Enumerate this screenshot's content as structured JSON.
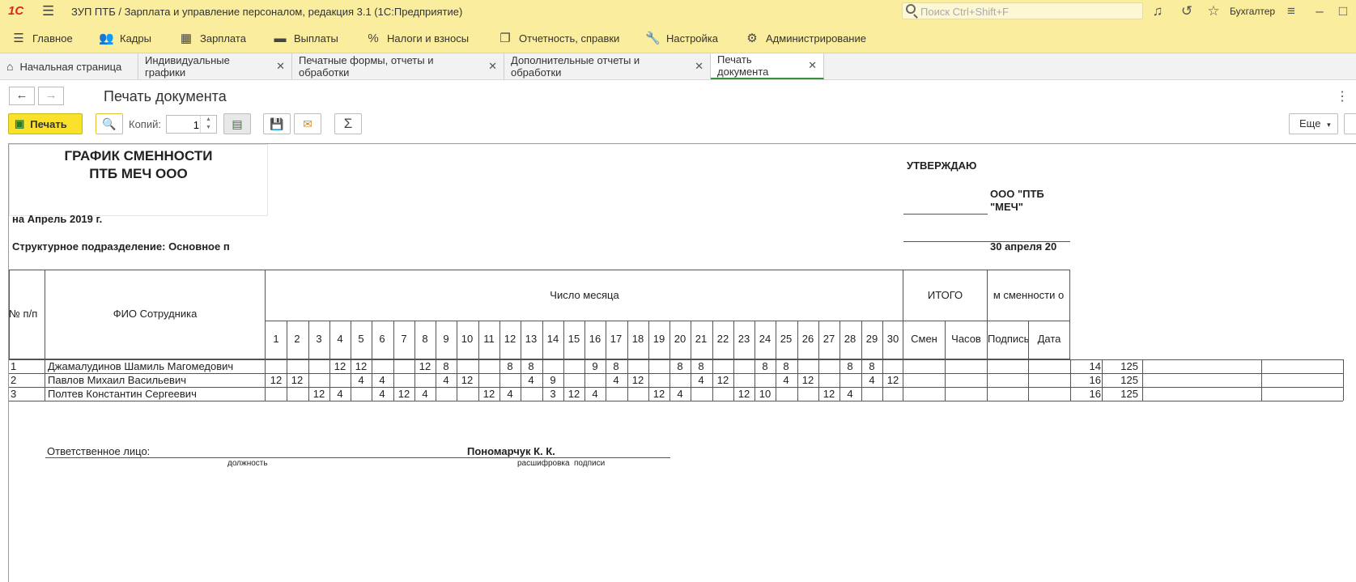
{
  "window": {
    "logo": "1С",
    "title": "ЗУП ПТБ / Зарплата и управление персоналом, редакция 3.1  (1С:Предприятие)",
    "search_placeholder": "Поиск Ctrl+Shift+F",
    "user": "Бухгалтер"
  },
  "sections": [
    {
      "label": "Главное",
      "icon": "menu-lines-icon"
    },
    {
      "label": "Кадры",
      "icon": "people-icon"
    },
    {
      "label": "Зарплата",
      "icon": "calculator-icon"
    },
    {
      "label": "Выплаты",
      "icon": "wallet-icon"
    },
    {
      "label": "Налоги и взносы",
      "icon": "percent-icon"
    },
    {
      "label": "Отчетность, справки",
      "icon": "documents-icon"
    },
    {
      "label": "Настройка",
      "icon": "wrench-icon"
    },
    {
      "label": "Администрирование",
      "icon": "gear-icon"
    }
  ],
  "tabs": [
    {
      "label": "Начальная страница",
      "closable": false,
      "active": false
    },
    {
      "label": "Индивидуальные графики",
      "closable": true,
      "active": false
    },
    {
      "label": "Печатные формы, отчеты и обработки",
      "closable": true,
      "active": false
    },
    {
      "label": "Дополнительные отчеты и обработки",
      "closable": true,
      "active": false
    },
    {
      "label": "Печать документа",
      "closable": true,
      "active": true
    }
  ],
  "form": {
    "title": "Печать документа",
    "print_label": "Печать",
    "copies_label": "Копий:",
    "copies_value": "1",
    "more_label": "Еще"
  },
  "document": {
    "title_line1": "ГРАФИК СМЕННОСТИ",
    "title_line2": "ПТБ МЕЧ ООО",
    "approve": "УТВЕРЖДАЮ",
    "org_line1": "ООО \"ПТБ",
    "org_line2": "\"МЕЧ\"",
    "period": "на Апрель 2019 г.",
    "department": "Структурное подразделение: Основное п",
    "approve_date": "30 апреля 20",
    "headers": {
      "num": "№ п/п",
      "name": "ФИО Сотрудника",
      "month_days": "Число месяца",
      "total": "ИТОГО",
      "acquaint": "м сменности о",
      "shifts": "Смен",
      "hours": "Часов",
      "signature": "Подпись",
      "date": "Дата"
    },
    "days": [
      "1",
      "2",
      "3",
      "4",
      "5",
      "6",
      "7",
      "8",
      "9",
      "10",
      "11",
      "12",
      "13",
      "14",
      "15",
      "16",
      "17",
      "18",
      "19",
      "20",
      "21",
      "22",
      "23",
      "24",
      "25",
      "26",
      "27",
      "28",
      "29",
      "30"
    ],
    "rows": [
      {
        "num": "1",
        "name": "Джамалудинов Шамиль Магомедович",
        "days": [
          "",
          "",
          "",
          "12",
          "12",
          "",
          "",
          "12",
          "8",
          "",
          "",
          "8",
          "8",
          "",
          "",
          "9",
          "8",
          "",
          "",
          "8",
          "8",
          "",
          "",
          "8",
          "8",
          "",
          "",
          "8",
          "8",
          ""
        ],
        "extra1": "14",
        "extra2": "125"
      },
      {
        "num": "2",
        "name": "Павлов Михаил Васильевич",
        "days": [
          "12",
          "12",
          "",
          "",
          "4",
          "4",
          "",
          "",
          "4",
          "12",
          "",
          "",
          "4",
          "9",
          "",
          "",
          "4",
          "12",
          "",
          "",
          "4",
          "12",
          "",
          "",
          "4",
          "12",
          "",
          "",
          "4",
          "12"
        ],
        "extra1": "16",
        "extra2": "125"
      },
      {
        "num": "3",
        "name": "Полтев Константин Сергеевич",
        "days": [
          "",
          "",
          "12",
          "4",
          "",
          "4",
          "12",
          "4",
          "",
          "",
          "12",
          "4",
          "",
          "3",
          "12",
          "4",
          "",
          "",
          "12",
          "4",
          "",
          "",
          "12",
          "10",
          "",
          "",
          "12",
          "4",
          "",
          ""
        ],
        "extra1": "16",
        "extra2": "125"
      }
    ],
    "responsible_label": "Ответственное лицо:",
    "responsible_name": "Пономарчук К. К.",
    "position_caption": "должность",
    "decode_caption": "расшифровка",
    "signature_caption": "подписи"
  }
}
